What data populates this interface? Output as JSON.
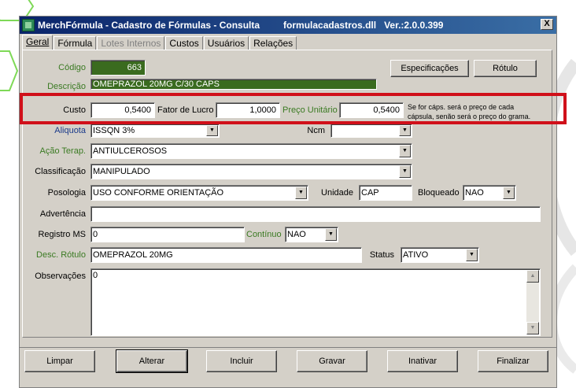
{
  "window": {
    "title": "MerchFórmula - Cadastro de Fórmulas - Consulta",
    "dll": "formulacadastros.dll",
    "version": "Ver.:2.0.0.399",
    "close_label": "X"
  },
  "tabs": [
    {
      "label": "Geral",
      "active": true
    },
    {
      "label": "Fórmula"
    },
    {
      "label": "Lotes Internos",
      "disabled": true
    },
    {
      "label": "Custos"
    },
    {
      "label": "Usuários"
    },
    {
      "label": "Relações"
    }
  ],
  "form": {
    "codigo_label": "Código",
    "codigo_value": "663",
    "descricao_label": "Descrição",
    "descricao_value": "OMEPRAZOL 20MG C/30 CAPS",
    "especificacoes_button": "Especificações",
    "rotulo_button": "Rótulo",
    "custo_label": "Custo",
    "custo_value": "0,5400",
    "fator_label": "Fator de Lucro",
    "fator_value": "1,0000",
    "preco_label": "Preço Unitário",
    "preco_value": "0,5400",
    "note_line1": "Se for cáps. será o preço de cada",
    "note_line2": "cápsula, senão será o preço do grama.",
    "aliquota_label": "Aliquota",
    "aliquota_value": "ISSQN 3%",
    "ncm_label": "Ncm",
    "ncm_value": "",
    "acao_label": "Ação Terap.",
    "acao_value": "ANTIULCEROSOS",
    "classificacao_label": "Classificação",
    "classificacao_value": "MANIPULADO",
    "posologia_label": "Posologia",
    "posologia_value": "USO CONFORME ORIENTAÇÃO",
    "unidade_label": "Unidade",
    "unidade_value": "CAP",
    "bloqueado_label": "Bloqueado",
    "bloqueado_value": "NAO",
    "advertencia_label": "Advertência",
    "advertencia_value": "",
    "registro_label": "Registro MS",
    "registro_value": "0",
    "continuo_label": "Contínuo",
    "continuo_value": "NAO",
    "desc_rotulo_label": "Desc. Rótulo",
    "desc_rotulo_value": "OMEPRAZOL 20MG",
    "status_label": "Status",
    "status_value": "ATIVO",
    "observacoes_label": "Observações",
    "observacoes_value": "0"
  },
  "buttons": {
    "limpar": "Limpar",
    "alterar": "Alterar",
    "incluir": "Incluir",
    "gravar": "Gravar",
    "inativar": "Inativar",
    "finalizar": "Finalizar"
  },
  "colors": {
    "title_start": "#0a246a",
    "highlight": "#d0101a",
    "green_field": "#3a6b1f"
  }
}
